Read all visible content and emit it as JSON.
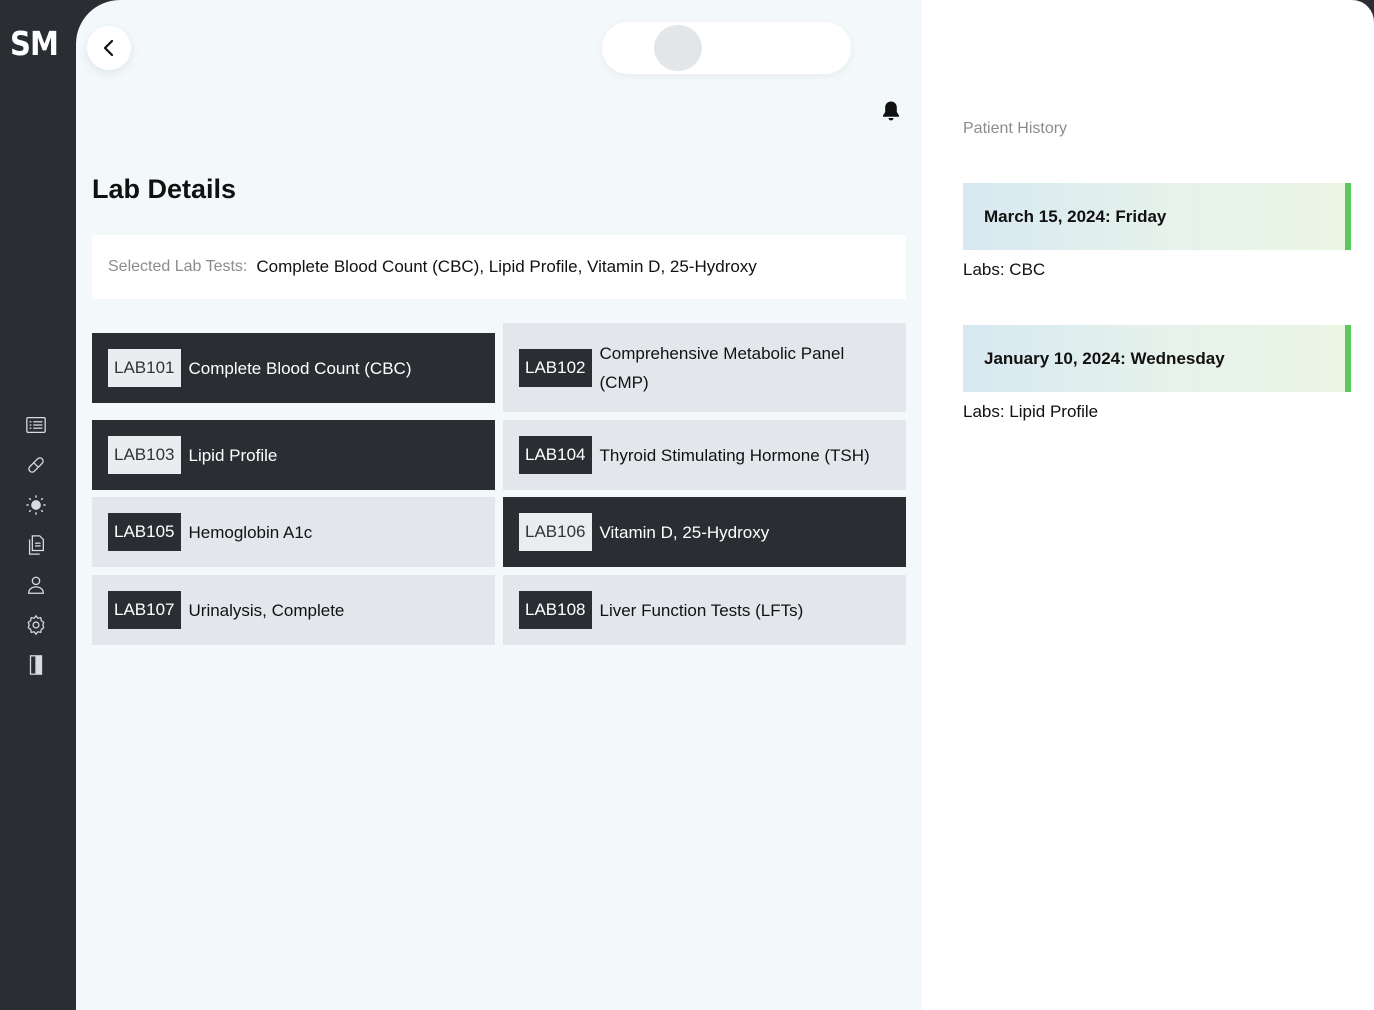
{
  "sidebar": {
    "logo": "SM",
    "icons": [
      "list-icon",
      "pill-icon",
      "sun-icon",
      "documents-icon",
      "user-icon",
      "gear-icon",
      "door-icon"
    ]
  },
  "header": {
    "back_icon": "chevron-left-icon",
    "notification_icon": "bell-icon"
  },
  "main": {
    "title": "Lab Details",
    "selected_label": "Selected Lab Tests:",
    "selected_value": "Complete Blood Count (CBC), Lipid Profile, Vitamin D, 25-Hydroxy",
    "labs": [
      {
        "code": "LAB101",
        "name": "Complete Blood Count (CBC)",
        "selected": true
      },
      {
        "code": "LAB102",
        "name": "Comprehensive Metabolic Panel (CMP)",
        "selected": false
      },
      {
        "code": "LAB103",
        "name": "Lipid Profile",
        "selected": true
      },
      {
        "code": "LAB104",
        "name": "Thyroid Stimulating Hormone (TSH)",
        "selected": false
      },
      {
        "code": "LAB105",
        "name": "Hemoglobin A1c",
        "selected": false
      },
      {
        "code": "LAB106",
        "name": "Vitamin D, 25-Hydroxy",
        "selected": true
      },
      {
        "code": "LAB107",
        "name": "Urinalysis, Complete",
        "selected": false
      },
      {
        "code": "LAB108",
        "name": "Liver Function Tests (LFTs)",
        "selected": false
      }
    ]
  },
  "history": {
    "title": "Patient History",
    "entries": [
      {
        "date": "March 15, 2024: Friday",
        "labs": "Labs: CBC"
      },
      {
        "date": "January 10, 2024: Wednesday",
        "labs": "Labs: Lipid Profile"
      }
    ]
  },
  "colors": {
    "dark": "#2a2e33",
    "background": "#f3f8fb",
    "card_light": "#e3e7ec",
    "accent_green": "#5cc85c"
  }
}
